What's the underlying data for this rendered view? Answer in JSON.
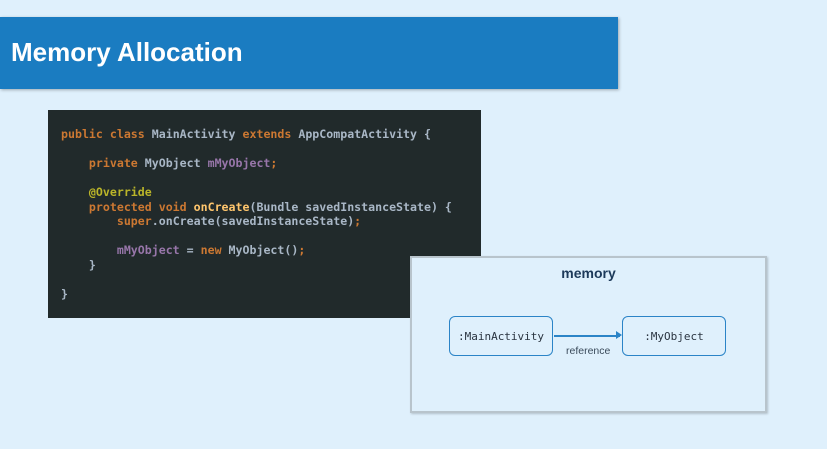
{
  "header": {
    "title": "Memory Allocation"
  },
  "code": {
    "lines": [
      [
        [
          "k",
          "public class "
        ],
        [
          "p",
          "MainActivity "
        ],
        [
          "k",
          "extends "
        ],
        [
          "p",
          "AppCompatActivity {"
        ]
      ],
      [],
      [
        [
          "p",
          "    "
        ],
        [
          "k",
          "private "
        ],
        [
          "p",
          "MyObject "
        ],
        [
          "v",
          "mMyObject"
        ],
        [
          "k",
          ";"
        ]
      ],
      [],
      [
        [
          "p",
          "    "
        ],
        [
          "a",
          "@Override"
        ]
      ],
      [
        [
          "p",
          "    "
        ],
        [
          "k",
          "protected void "
        ],
        [
          "f",
          "onCreate"
        ],
        [
          "p",
          "(Bundle savedInstanceState) {"
        ]
      ],
      [
        [
          "p",
          "        "
        ],
        [
          "k",
          "super"
        ],
        [
          "p",
          ".onCreate(savedInstanceState)"
        ],
        [
          "k",
          ";"
        ]
      ],
      [],
      [
        [
          "p",
          "        "
        ],
        [
          "v",
          "mMyObject "
        ],
        [
          "p",
          "= "
        ],
        [
          "k",
          "new "
        ],
        [
          "p",
          "MyObject()"
        ],
        [
          "k",
          ";"
        ]
      ],
      [
        [
          "p",
          "    }"
        ]
      ],
      [],
      [
        [
          "p",
          "}"
        ]
      ]
    ]
  },
  "diagram": {
    "title": "memory",
    "source": ":MainActivity",
    "target": ":MyObject",
    "edge_label": "reference"
  }
}
